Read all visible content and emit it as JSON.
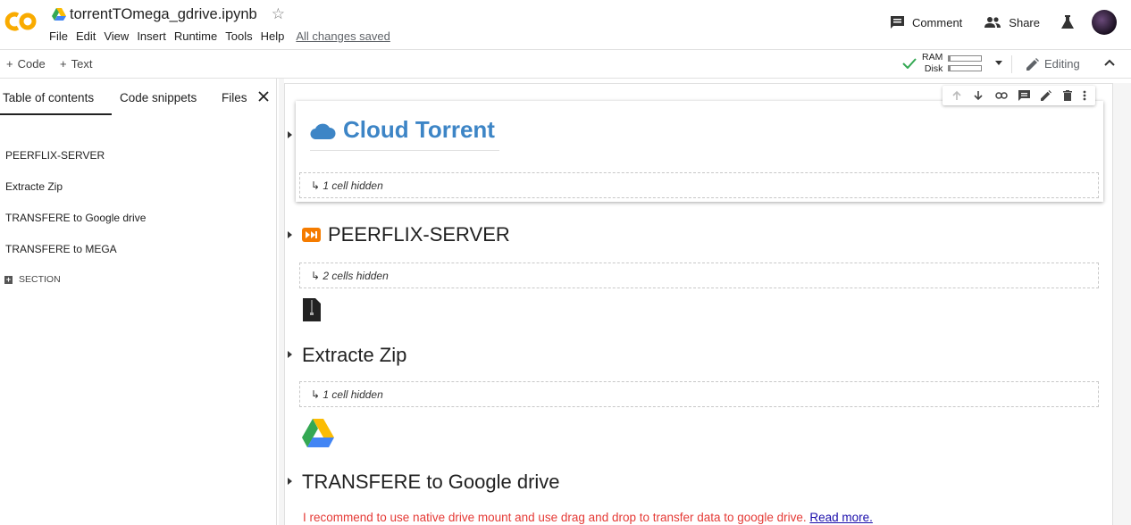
{
  "app": {
    "notebook_title": "torrentTOmega_gdrive.ipynb",
    "menus": [
      "File",
      "Edit",
      "View",
      "Insert",
      "Runtime",
      "Tools",
      "Help"
    ],
    "save_status": "All changes saved",
    "comment_label": "Comment",
    "share_label": "Share"
  },
  "toolbar": {
    "add_code": "Code",
    "add_text": "Text",
    "ram_label": "RAM",
    "disk_label": "Disk",
    "editing_label": "Editing"
  },
  "sidebar": {
    "tabs": [
      "Table of contents",
      "Code snippets",
      "Files"
    ],
    "toc": [
      "PEERFLIX-SERVER",
      "Extracte Zip",
      "TRANSFERE to Google drive",
      "TRANSFERE to MEGA"
    ],
    "add_section": "SECTION"
  },
  "notebook": {
    "title_heading": "Cloud Torrent",
    "hidden1": "1 cell hidden",
    "heading_peerflix": "PEERFLIX-SERVER",
    "hidden2": "2 cells hidden",
    "heading_extract": "Extracte Zip",
    "hidden3": "1 cell hidden",
    "heading_transfer": "TRANSFERE to Google drive",
    "note_text": "I recommend to use native drive mount and use drag and drop to transfer data to google drive. ",
    "note_link": "Read more."
  },
  "colors": {
    "accent_blue": "#3d85c6",
    "note_red": "#e53935",
    "colab_orange": "#f9ab00",
    "check_green": "#34a853"
  }
}
